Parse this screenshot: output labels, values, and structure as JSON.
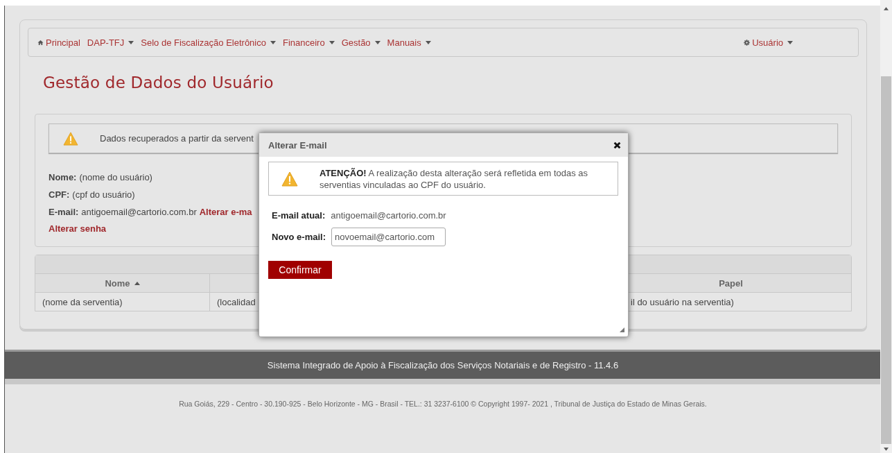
{
  "nav": {
    "items": [
      {
        "label": "Principal",
        "kind": "home"
      },
      {
        "label": "DAP-TFJ",
        "kind": "menu"
      },
      {
        "label": "Selo de Fiscalização Eletrônico",
        "kind": "menu"
      },
      {
        "label": "Financeiro",
        "kind": "menu"
      },
      {
        "label": "Gestão",
        "kind": "menu"
      },
      {
        "label": "Manuais",
        "kind": "menu"
      }
    ],
    "user_menu": {
      "label": "Usuário"
    }
  },
  "page_title": "Gestão de Dados do Usuário",
  "notice": "Dados recuperados a partir da servent",
  "fields": [
    {
      "label": "Nome:",
      "value": "(nome do usuário)"
    },
    {
      "label": "CPF:",
      "value": "(cpf do usuário)"
    },
    {
      "label": "E-mail:",
      "value": "antigoemail@cartorio.com.br",
      "link": "Alterar e-ma"
    }
  ],
  "change_password_link": "Alterar senha",
  "table": {
    "columns": [
      {
        "label": "Nome",
        "sorted_ascending": true
      },
      null,
      {
        "label": "Papel",
        "sorted_ascending": false
      }
    ],
    "rows": [
      {
        "cells": [
          "(nome da serventia)",
          "(localidad",
          "il do usuário na serventia)"
        ]
      }
    ]
  },
  "modal": {
    "title": "Alterar E-mail",
    "warning": "**ATENÇÃO!** A realização desta alteração será refletida em todas as serventias vinculadas ao CPF do usuário.",
    "current_email": {
      "label": "E-mail atual:",
      "value": "antigoemail@cartorio.com.br"
    },
    "new_email": {
      "label": "Novo e-mail:",
      "value": "novoemail@cartorio.com"
    },
    "confirm_button": "Confirmar"
  },
  "footer": {
    "system": "Sistema Integrado de Apoio à Fiscalização dos Serviços Notariais e de Registro - 11.4.6",
    "address": "Rua Goiás, 229 - Centro - 30.190-925 - Belo Horizonte - MG - Brasil - TEL.: 31 3237-6100 © Copyright 1997- 2021 , Tribunal de Justiça do Estado de Minas Gerais."
  }
}
